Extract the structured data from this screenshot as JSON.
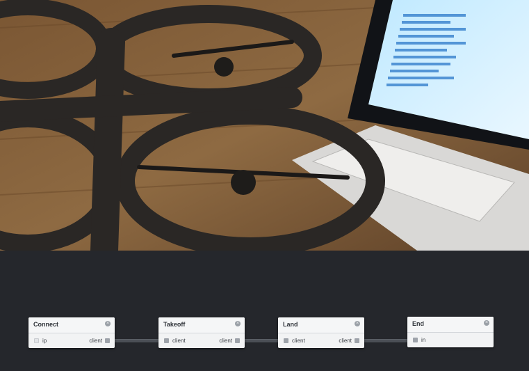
{
  "photo": {
    "description_icon": "drone-photo-image"
  },
  "nodes": [
    {
      "title": "Connect",
      "inputs": [
        {
          "label": "ip",
          "connected": false
        }
      ],
      "outputs": [
        {
          "label": "client"
        }
      ]
    },
    {
      "title": "Takeoff",
      "inputs": [
        {
          "label": "client",
          "connected": true
        }
      ],
      "outputs": [
        {
          "label": "client"
        }
      ]
    },
    {
      "title": "Land",
      "inputs": [
        {
          "label": "client",
          "connected": true
        }
      ],
      "outputs": [
        {
          "label": "client"
        }
      ]
    },
    {
      "title": "End",
      "inputs": [
        {
          "label": "in",
          "connected": true
        }
      ],
      "outputs": []
    }
  ],
  "colors": {
    "editor_background": "#25272c",
    "node_background": "#f2f3f4",
    "wire": "#4c5057"
  }
}
